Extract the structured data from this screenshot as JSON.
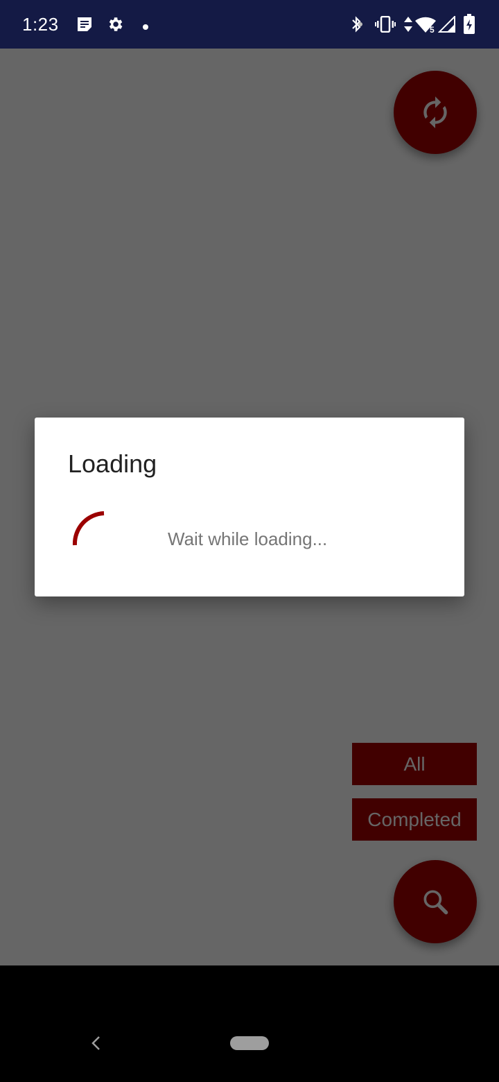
{
  "status_bar": {
    "time": "1:23",
    "left_icons": [
      "notes-icon",
      "settings-gear-icon",
      "notification-dot-icon"
    ],
    "right_icons": [
      "bluetooth-icon",
      "vibrate-icon",
      "data-arrows-icon",
      "wifi-icon",
      "cellular-signal-icon",
      "battery-charging-icon"
    ],
    "wifi_badge": "5",
    "background_color": "#141a45"
  },
  "app": {
    "accent_color": "#a30000",
    "refresh_button": {
      "icon": "refresh-icon",
      "label": "Refresh"
    },
    "filters": [
      {
        "label": "All"
      },
      {
        "label": "Completed"
      }
    ],
    "search_button": {
      "icon": "search-icon",
      "label": "Search"
    }
  },
  "dialog": {
    "title": "Loading",
    "message": "Wait while loading...",
    "spinner_color": "#9b0000"
  },
  "nav_bar": {
    "back": "back-icon",
    "home": "home-pill"
  }
}
